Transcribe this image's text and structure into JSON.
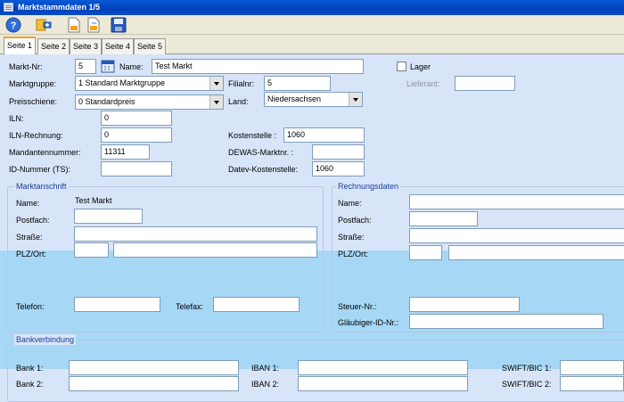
{
  "window": {
    "title": "Marktstammdaten 1/5"
  },
  "toolbar": {
    "icons": [
      "help-icon",
      "new-record-icon",
      "open-document-icon",
      "copy-document-icon",
      "save-disk-icon"
    ]
  },
  "tabs": [
    "Seite 1",
    "Seite 2",
    "Seite 3",
    "Seite 4",
    "Seite 5"
  ],
  "form": {
    "markt_nr_label": "Markt-Nr:",
    "markt_nr": "5",
    "name_label": "Name:",
    "name": "Test Markt",
    "marktgruppe_label": "Marktgruppe:",
    "marktgruppe": "1 Standard Marktgruppe",
    "filialnr_label": "Filialnr:",
    "filialnr": "5",
    "preisschiene_label": "Preisschiene:",
    "preisschiene": "0 Standardpreis",
    "land_label": "Land:",
    "land": "Niedersachsen",
    "lager_label": "Lager",
    "lager_checked": false,
    "lieferant_label": "Lieferant:",
    "lieferant": "",
    "iln_label": "ILN:",
    "iln": "0",
    "iln_rechnung_label": "ILN-Rechnung:",
    "iln_rechnung": "0",
    "kostenstelle_label": "Kostenstelle :",
    "kostenstelle": "1060",
    "mandantennummer_label": "Mandantennummer:",
    "mandantennummer": "11311",
    "dewas_label": "DEWAS-Marktnr. :",
    "dewas": "",
    "id_nummer_label": "ID-Nummer (TS):",
    "id_nummer": "",
    "datev_label": "Datev-Kostenstelle:",
    "datev": "1060"
  },
  "marktanschrift": {
    "title": "Marktanschrift",
    "name_label": "Name:",
    "name": "Test Markt",
    "postfach_label": "Postfach:",
    "postfach": "",
    "strasse_label": "Straße:",
    "strasse": "",
    "plz_ort_label": "PLZ/Ort:",
    "plz": "",
    "ort": "",
    "telefon_label": "Telefon:",
    "telefon": "",
    "telefax_label": "Telefax:",
    "telefax": ""
  },
  "rechnungsdaten": {
    "title": "Rechnungsdaten",
    "name_label": "Name:",
    "name": "",
    "postfach_label": "Postfach:",
    "postfach": "",
    "strasse_label": "Straße:",
    "strasse": "",
    "plz_ort_label": "PLZ/Ort:",
    "plz": "",
    "ort": "",
    "steuer_label": "Steuer-Nr.:",
    "steuer": "",
    "glaeubiger_label": "Gläubiger-ID-Nr.:",
    "glaeubiger": ""
  },
  "bank": {
    "title": "Bankverbindung",
    "bank1_label": "Bank 1:",
    "bank1": "",
    "bank2_label": "Bank 2:",
    "bank2": "",
    "iban1_label": "IBAN 1:",
    "iban1": "",
    "iban2_label": "IBAN 2:",
    "iban2": "",
    "swift1_label": "SWIFT/BIC 1:",
    "swift1": "",
    "swift2_label": "SWIFT/BIC 2:",
    "swift2": ""
  }
}
